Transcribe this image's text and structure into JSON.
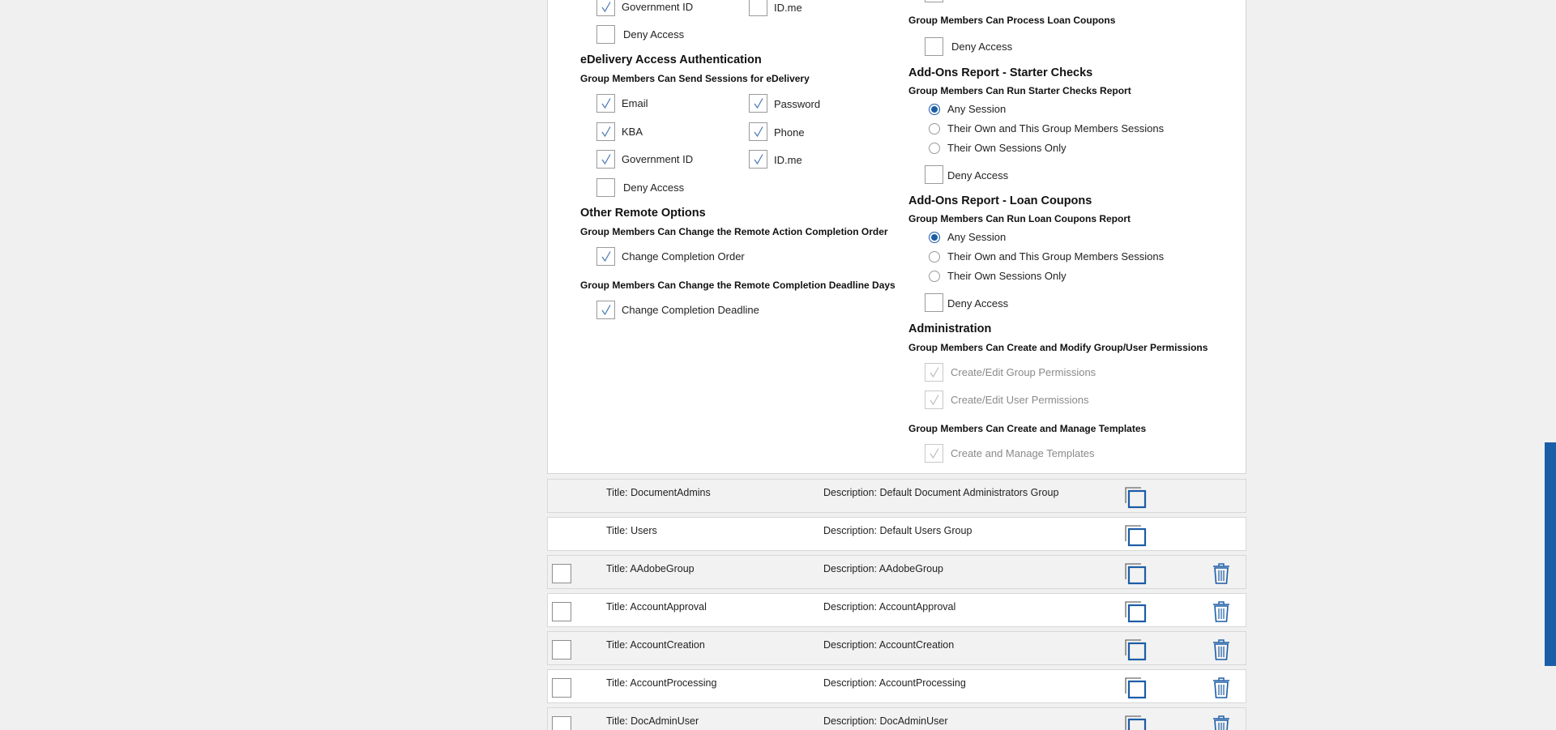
{
  "colors": {
    "accent": "#1c5da6",
    "check": "#4a78b5",
    "panel_bg": "#ffffff",
    "page_bg": "#f0f0f0"
  },
  "left": {
    "top_items": {
      "gov_id": "Government ID",
      "idme": "ID.me",
      "deny": "Deny Access"
    },
    "edelivery": {
      "heading": "eDelivery Access Authentication",
      "sub": "Group Members Can Send Sessions for eDelivery",
      "email": "Email",
      "password": "Password",
      "kba": "KBA",
      "phone": "Phone",
      "gov_id": "Government ID",
      "idme": "ID.me",
      "deny": "Deny Access"
    },
    "other_remote": {
      "heading": "Other Remote Options",
      "sub1": "Group Members Can Change the Remote Action Completion Order",
      "opt1": "Change Completion Order",
      "sub2": "Group Members Can Change the Remote Completion Deadline Days",
      "opt2": "Change Completion Deadline"
    }
  },
  "right": {
    "loan_coupons": {
      "sub": "Group Members Can Process Loan Coupons",
      "deny": "Deny Access"
    },
    "starter_checks": {
      "heading": "Add-Ons Report - Starter Checks",
      "sub": "Group Members Can Run Starter Checks Report",
      "any": "Any Session",
      "own_group": "Their Own and This Group Members Sessions",
      "own_only": "Their Own Sessions Only",
      "deny": "Deny Access"
    },
    "loan_report": {
      "heading": "Add-Ons Report - Loan Coupons",
      "sub": "Group Members Can Run Loan Coupons Report",
      "any": "Any Session",
      "own_group": "Their Own and This Group Members Sessions",
      "own_only": "Their Own Sessions Only",
      "deny": "Deny Access"
    },
    "admin": {
      "heading": "Administration",
      "sub1": "Group Members Can Create and Modify Group/User Permissions",
      "opt1": "Create/Edit Group Permissions",
      "opt2": "Create/Edit User Permissions",
      "sub2": "Group Members Can Create and Manage Templates",
      "opt3": "Create and Manage Templates"
    }
  },
  "groups": [
    {
      "title": "Title:  DocumentAdmins",
      "desc": "Description: Default Document Administrators Group"
    },
    {
      "title": "Title:  Users",
      "desc": "Description: Default Users Group"
    },
    {
      "title": "Title:  AAdobeGroup",
      "desc": "Description: AAdobeGroup"
    },
    {
      "title": "Title:  AccountApproval",
      "desc": "Description: AccountApproval"
    },
    {
      "title": "Title:  AccountCreation",
      "desc": "Description: AccountCreation"
    },
    {
      "title": "Title:  AccountProcessing",
      "desc": "Description: AccountProcessing"
    },
    {
      "title": "Title:  DocAdminUser",
      "desc": "Description: DocAdminUser"
    }
  ]
}
